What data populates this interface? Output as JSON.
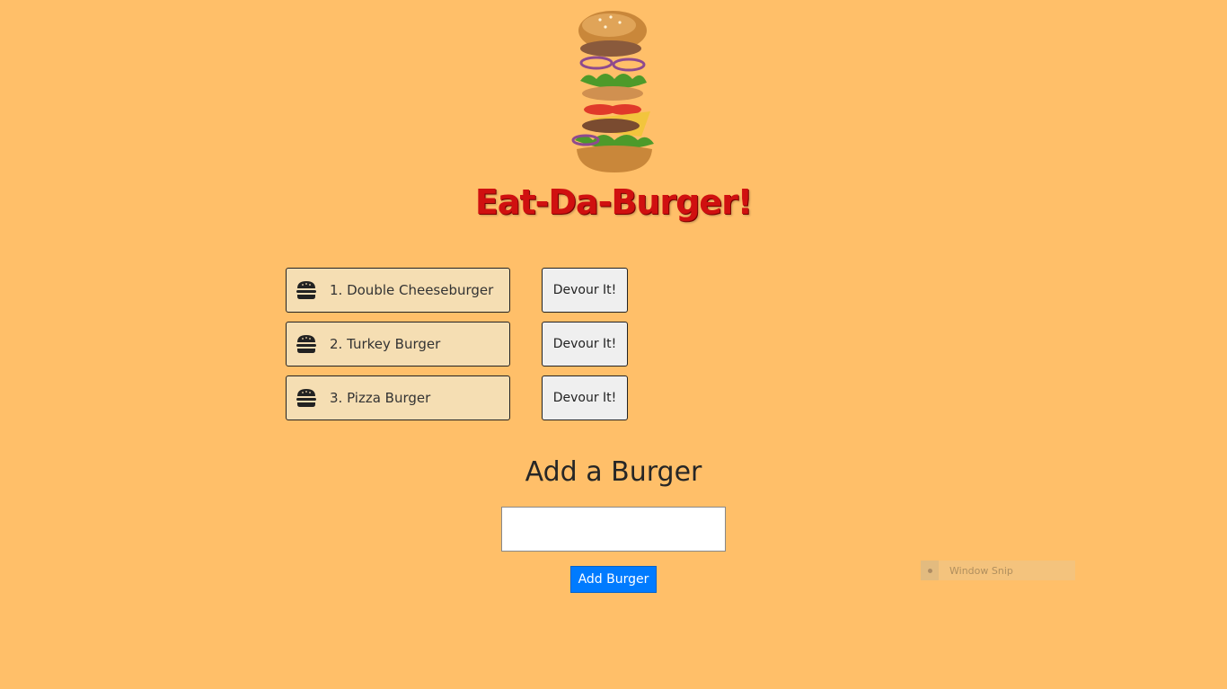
{
  "header": {
    "title": "Eat-Da-Burger!",
    "logo_icon": "stacked-burger-icon"
  },
  "burgers": [
    {
      "label": "1. Double Cheeseburger",
      "icon": "hamburger-icon",
      "action_label": "Devour It!"
    },
    {
      "label": "2. Turkey Burger",
      "icon": "hamburger-icon",
      "action_label": "Devour It!"
    },
    {
      "label": "3. Pizza Burger",
      "icon": "hamburger-icon",
      "action_label": "Devour It!"
    }
  ],
  "add_form": {
    "heading": "Add a Burger",
    "input_value": "",
    "submit_label": "Add Burger"
  },
  "overlay": {
    "snip_label": "Window Snip"
  },
  "colors": {
    "background": "#ffbf69",
    "title": "#d01010",
    "item_bg": "#f5deb3",
    "primary_button": "#007bff"
  }
}
